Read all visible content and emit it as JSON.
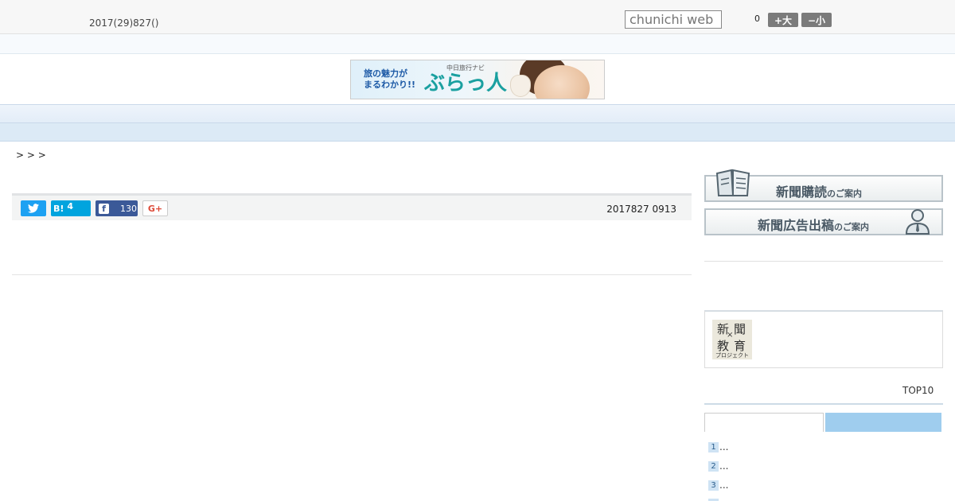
{
  "header": {
    "date": "2017(29)827()",
    "search_placeholder": "chunichi web",
    "zoom_value": "0",
    "font_large_label": "+大",
    "font_small_label": "−小"
  },
  "banner": {
    "tagline_line1": "旅の魅力が",
    "tagline_line2": "まるわかり!!",
    "sub": "中日旅行ナビ",
    "brand": "ぶらっ人"
  },
  "nav": {
    "items": [
      "",
      "",
      "",
      "",
      "",
      "",
      "",
      "",
      ""
    ]
  },
  "breadcrumb": "> > >",
  "article": {
    "share": {
      "hatena_label": "B!",
      "hatena_count": "4",
      "facebook_count": "130",
      "gplus_label": "G+"
    },
    "published": "2017827 0913"
  },
  "sidebar": {
    "subscription_banner": {
      "main": "新聞購読",
      "suffix": "のご案内"
    },
    "advertising_banner": {
      "main": "新聞広告出稿",
      "suffix": "のご案内"
    },
    "project_logo": {
      "c1": "新",
      "c2": "聞",
      "c3": "教",
      "c4": "育",
      "x": "×",
      "caption": "プロジェクト"
    },
    "ranking_title": "TOP10",
    "ranking": [
      {
        "num": "1",
        "text": "..."
      },
      {
        "num": "2",
        "text": "..."
      },
      {
        "num": "3",
        "text": "..."
      }
    ]
  },
  "colors": {
    "nav_bg": "#e3edf8",
    "twitter": "#1da1f2",
    "hatena": "#00a4de",
    "facebook": "#3b5998",
    "gplus": "#dd4b39",
    "ranking_tab_active": "#9fcdee"
  }
}
